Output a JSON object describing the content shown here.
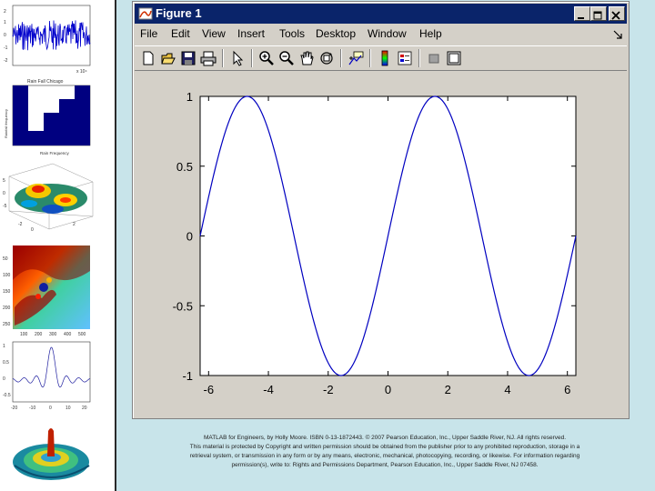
{
  "window": {
    "title": "Figure 1"
  },
  "menu": [
    "File",
    "Edit",
    "View",
    "Insert",
    "Tools",
    "Desktop",
    "Window",
    "Help"
  ],
  "toolbar_icons": [
    "new-file-icon",
    "open-folder-icon",
    "save-icon",
    "print-icon",
    "pointer-arrow-icon",
    "zoom-in-icon",
    "zoom-out-icon",
    "pan-hand-icon",
    "rotate-3d-icon",
    "data-cursor-icon",
    "colorbar-icon",
    "legend-icon",
    "hide-plot-tools-icon",
    "show-plot-tools-icon"
  ],
  "chart_data": {
    "type": "line",
    "series": [
      {
        "function": "sin(x)",
        "x_range": [
          -6.2832,
          6.2832
        ]
      }
    ],
    "xlim": [
      -6.2832,
      6.2832
    ],
    "ylim": [
      -1,
      1
    ],
    "xticks": [
      "-6",
      "-4",
      "-2",
      "0",
      "2",
      "4",
      "6"
    ],
    "yticks": [
      "1",
      "0.5",
      "0",
      "-0.5",
      "-1"
    ],
    "line_color": "#0000c0",
    "grid": false
  },
  "footer": {
    "line1": "MATLAB for Engineers, by Holly Moore. ISBN 0-13-1872443. © 2007 Pearson Education, Inc., Upper Saddle River, NJ. All rights reserved.",
    "line2": "This material is protected by Copyright and written permission should be obtained from the publisher prior to any prohibited reproduction, storage in a",
    "line3": "retrieval system, or transmission in any form or by any means, electronic, mechanical, photocopying, recording, or likewise. For information regarding",
    "line4": "permission(s), write to: Rights and Permissions Department, Pearson Education, Inc., Upper Saddle River, NJ 07458."
  },
  "thumbs": {
    "t1": {
      "yticks": [
        "2",
        "1",
        "0",
        "-1",
        "-2"
      ],
      "xnote": "x 10⁴"
    },
    "t2": {
      "title": "Rain Fall Chicago",
      "ylabel": "Rainfall frequency",
      "xlabel": "Rain Frequency"
    },
    "t3": {
      "zticks": [
        "5",
        "0",
        "-5"
      ],
      "xticks": [
        "-2",
        "0",
        "2"
      ]
    },
    "t4": {
      "yticks": [
        "50",
        "100",
        "150",
        "200",
        "250"
      ],
      "xticks": [
        "100",
        "200",
        "300",
        "400",
        "500"
      ]
    },
    "t5": {
      "yticks": [
        "1",
        "0.5",
        "0",
        "-0.5"
      ],
      "xticks": [
        "-20",
        "-10",
        "0",
        "10",
        "20"
      ]
    }
  }
}
